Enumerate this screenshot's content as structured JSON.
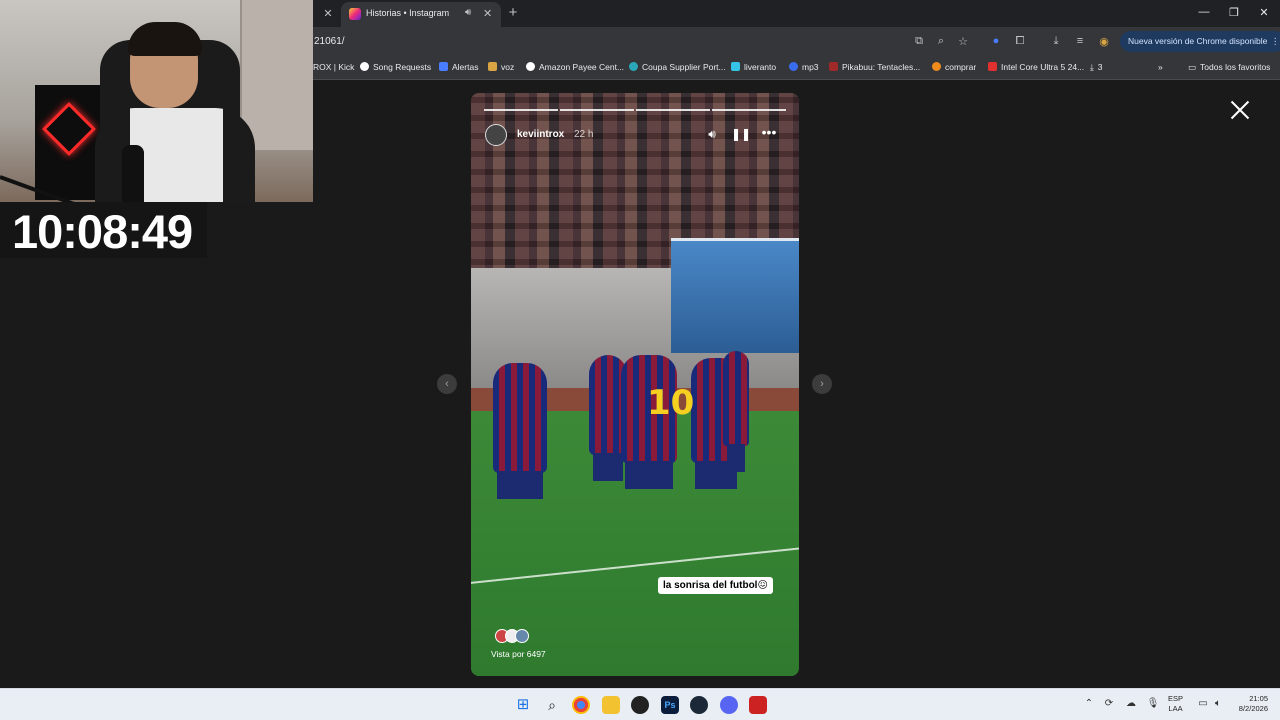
{
  "browser": {
    "tab": {
      "title": "Historias • Instagram"
    },
    "url": "21061/",
    "update_button": "Nueva versión de Chrome disponible",
    "bookmarks": [
      {
        "label": "ROX | Kick",
        "color": "#53fc18"
      },
      {
        "label": "Song Requests",
        "color": "#ffffff"
      },
      {
        "label": "Alertas",
        "color": "#4a7cff"
      },
      {
        "label": "voz",
        "color": "#d9a441"
      },
      {
        "label": "Amazon Payee Cent...",
        "color": "#ffffff"
      },
      {
        "label": "Coupa Supplier Port...",
        "color": "#2aa7b8"
      },
      {
        "label": "liveranto",
        "color": "#35c4e8"
      },
      {
        "label": "mp3",
        "color": "#3a6cf0"
      },
      {
        "label": "Pikabuu: Tentacles...",
        "color": "#a02a2a"
      },
      {
        "label": "comprar",
        "color": "#f08a1c"
      },
      {
        "label": "Intel Core Ultra 5 24...",
        "color": "#e03030"
      },
      {
        "label": "3",
        "color": "#cccccc"
      }
    ],
    "all_bookmarks": "Todos los favoritos"
  },
  "story": {
    "username": "keviintrox",
    "time_ago": "22 h",
    "caption": "la sonrisa del futbol😖",
    "viewed_by": "Vista por 6497",
    "jersey_number": "10",
    "progress_segments": 4
  },
  "overlay": {
    "timer": "10:08:49"
  },
  "taskbar": {
    "language_line1": "ESP",
    "language_line2": "LAA",
    "time": "21:05",
    "date": "8/2/2026"
  }
}
